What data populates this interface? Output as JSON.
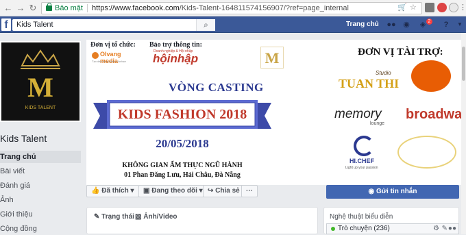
{
  "browser": {
    "secure_label": "Bảo mật",
    "url_host": "https://www.facebook.com",
    "url_path": "/Kids-Talent-164811574156907/?ref=page_internal"
  },
  "fb": {
    "search_value": "Kids Talent",
    "home_label": "Trang chủ",
    "notif_count": "2"
  },
  "page": {
    "name": "Kids Talent",
    "logo_letter": "M",
    "logo_text": "KIDS TALENT",
    "nav": [
      "Trang chủ",
      "Bài viết",
      "Đánh giá",
      "Ảnh",
      "Giới thiệu",
      "Cộng đồng"
    ]
  },
  "cover": {
    "organizer_label": "Đơn vị tổ chức:",
    "organizer_name": "Olvang media",
    "organizer_sub": "Tạo dấu ấn sự kiện của bạn",
    "sponsor_info_label": "Bảo trợ thông tin:",
    "hoinhap_small": "Doanh nghiệp & Hội nhập",
    "hoinhap": "hộinhập",
    "center_logo": "M",
    "sponsors_title": "ĐƠN VỊ TÀI TRỢ:",
    "casting": "VÒNG CASTING",
    "event": "KIDS FASHION 2018",
    "date": "20/05/2018",
    "venue": "KHÔNG GIAN ẨM THỰC NGŨ HÀNH",
    "address": "01 Phan Đăng Lưu, Hải Châu, Đà Nẵng",
    "sponsor_tuanthi": "TUAN THI",
    "sponsor_tuanthi_small": "Studio",
    "sponsor_memory": "memory",
    "sponsor_memory_sub": "lounge",
    "sponsor_broadway": "broadway",
    "sponsor_hichef": "HI.CHEF",
    "sponsor_hichef_sub": "Light up your passion"
  },
  "actions": {
    "like": "Đã thích",
    "follow": "Đang theo dõi",
    "share": "Chia sẻ",
    "more": "···",
    "message": "Gửi tin nhắn"
  },
  "composer": {
    "status": "Trạng thái",
    "photo": "Ảnh/Video"
  },
  "side": {
    "category": "Nghệ thuật biểu diễn",
    "chat": "Trò chuyện (236)"
  }
}
